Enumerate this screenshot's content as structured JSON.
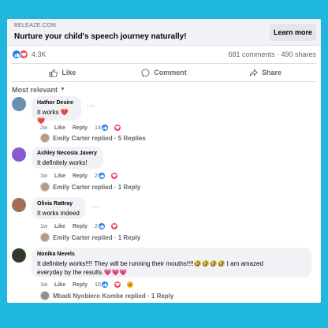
{
  "ad": {
    "domain": "BELEAZE.COM",
    "title": "Nurture your child's speech journey naturally!",
    "cta": "Learn more"
  },
  "stats": {
    "reactions": "4.3K",
    "comments_shares": "681 comments · 490 shares"
  },
  "actions": {
    "like": "Like",
    "comment": "Comment",
    "share": "Share"
  },
  "sort": {
    "label": "Most relevant"
  },
  "comments": [
    {
      "name": "Hathor Desire",
      "text": "It works ❤️❤️",
      "time": "2w",
      "like": "Like",
      "reply": "Reply",
      "count": "13",
      "replied": "Emily Carter replied · 5 Replies",
      "colors": {
        "avatar": "#6a8fb3",
        "reply_avatar": "#b99a7a"
      }
    },
    {
      "name": "Ashley Necosia Javery",
      "text": "It definitely works!",
      "time": "1w",
      "like": "Like",
      "reply": "Reply",
      "count": "2",
      "replied": "Emily Carter replied · 1 Reply",
      "colors": {
        "avatar": "#8a5bd1",
        "reply_avatar": "#b99a7a"
      }
    },
    {
      "name": "Olivia Rattray",
      "text": "It works indeed",
      "time": "1w",
      "like": "Like",
      "reply": "Reply",
      "count": "2",
      "replied": "Emily Carter replied · 1 Reply",
      "colors": {
        "avatar": "#a0705a",
        "reply_avatar": "#b99a7a"
      }
    },
    {
      "name": "Nonika Nevels",
      "text_line1": "It definitely works!!!! They will be running their mouths!!!!🤣🤣🤣🤣 I am amazed",
      "text_line2": "everyday by the results.💗💗💗",
      "time": "1w",
      "like": "Like",
      "reply": "Reply",
      "count": "10",
      "replied": "Mbadi Nyobiero Kombe replied · 1 Reply",
      "colors": {
        "avatar": "#2f3b2b",
        "reply_avatar": "#8f8f8f"
      }
    }
  ],
  "colors": {
    "background": "#1fb6e0",
    "like_blue": "#1877f2",
    "love_red": "#f33e58",
    "wow_yellow": "#f7b125"
  }
}
